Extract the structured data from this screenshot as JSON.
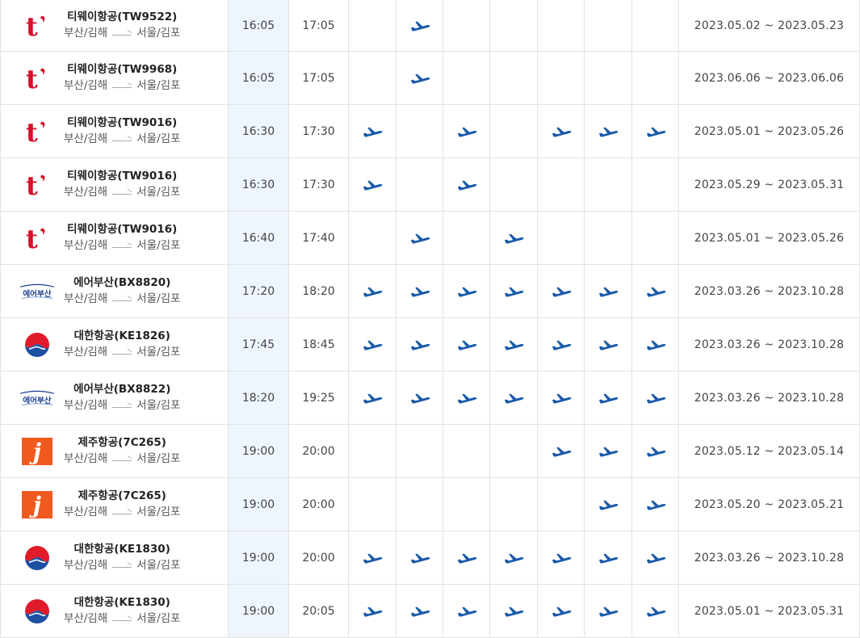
{
  "rows": [
    {
      "airline": "티웨이항공(TW9522)",
      "logo": "tway",
      "origin": "부산/김해",
      "dest": "서울/김포",
      "dep": "16:05",
      "arr": "17:05",
      "days": [
        0,
        1,
        0,
        0,
        0,
        0,
        0
      ],
      "period": "2023.05.02 ~ 2023.05.23"
    },
    {
      "airline": "티웨이항공(TW9968)",
      "logo": "tway",
      "origin": "부산/김해",
      "dest": "서울/김포",
      "dep": "16:05",
      "arr": "17:05",
      "days": [
        0,
        1,
        0,
        0,
        0,
        0,
        0
      ],
      "period": "2023.06.06 ~ 2023.06.06"
    },
    {
      "airline": "티웨이항공(TW9016)",
      "logo": "tway",
      "origin": "부산/김해",
      "dest": "서울/김포",
      "dep": "16:30",
      "arr": "17:30",
      "days": [
        1,
        0,
        1,
        0,
        1,
        1,
        1
      ],
      "period": "2023.05.01 ~ 2023.05.26"
    },
    {
      "airline": "티웨이항공(TW9016)",
      "logo": "tway",
      "origin": "부산/김해",
      "dest": "서울/김포",
      "dep": "16:30",
      "arr": "17:30",
      "days": [
        1,
        0,
        1,
        0,
        0,
        0,
        0
      ],
      "period": "2023.05.29 ~ 2023.05.31"
    },
    {
      "airline": "티웨이항공(TW9016)",
      "logo": "tway",
      "origin": "부산/김해",
      "dest": "서울/김포",
      "dep": "16:40",
      "arr": "17:40",
      "days": [
        0,
        1,
        0,
        1,
        0,
        0,
        0
      ],
      "period": "2023.05.01 ~ 2023.05.26"
    },
    {
      "airline": "에어부산(BX8820)",
      "logo": "airbusan",
      "origin": "부산/김해",
      "dest": "서울/김포",
      "dep": "17:20",
      "arr": "18:20",
      "days": [
        1,
        1,
        1,
        1,
        1,
        1,
        1
      ],
      "period": "2023.03.26 ~ 2023.10.28"
    },
    {
      "airline": "대한항공(KE1826)",
      "logo": "korean",
      "origin": "부산/김해",
      "dest": "서울/김포",
      "dep": "17:45",
      "arr": "18:45",
      "days": [
        1,
        1,
        1,
        1,
        1,
        1,
        1
      ],
      "period": "2023.03.26 ~ 2023.10.28"
    },
    {
      "airline": "에어부산(BX8822)",
      "logo": "airbusan",
      "origin": "부산/김해",
      "dest": "서울/김포",
      "dep": "18:20",
      "arr": "19:25",
      "days": [
        1,
        1,
        1,
        1,
        1,
        1,
        1
      ],
      "period": "2023.03.26 ~ 2023.10.28"
    },
    {
      "airline": "제주항공(7C265)",
      "logo": "jeju",
      "origin": "부산/김해",
      "dest": "서울/김포",
      "dep": "19:00",
      "arr": "20:00",
      "days": [
        0,
        0,
        0,
        0,
        1,
        1,
        1
      ],
      "period": "2023.05.12 ~ 2023.05.14"
    },
    {
      "airline": "제주항공(7C265)",
      "logo": "jeju",
      "origin": "부산/김해",
      "dest": "서울/김포",
      "dep": "19:00",
      "arr": "20:00",
      "days": [
        0,
        0,
        0,
        0,
        0,
        1,
        1
      ],
      "period": "2023.05.20 ~ 2023.05.21"
    },
    {
      "airline": "대한항공(KE1830)",
      "logo": "korean",
      "origin": "부산/김해",
      "dest": "서울/김포",
      "dep": "19:00",
      "arr": "20:00",
      "days": [
        1,
        1,
        1,
        1,
        1,
        1,
        1
      ],
      "period": "2023.03.26 ~ 2023.10.28"
    },
    {
      "airline": "대한항공(KE1830)",
      "logo": "korean",
      "origin": "부산/김해",
      "dest": "서울/김포",
      "dep": "19:00",
      "arr": "20:05",
      "days": [
        1,
        1,
        1,
        1,
        1,
        1,
        1
      ],
      "period": "2023.05.01 ~ 2023.05.31"
    }
  ],
  "logo_text": {
    "airbusan": "에어부산",
    "tway": "t",
    "jeju": "j"
  },
  "colors": {
    "plane": "#1a5aa8",
    "dep_bg": "#eef5fd",
    "tway": "#d5112a",
    "jeju": "#f05a1e",
    "airbusan": "#1c3f8f"
  }
}
